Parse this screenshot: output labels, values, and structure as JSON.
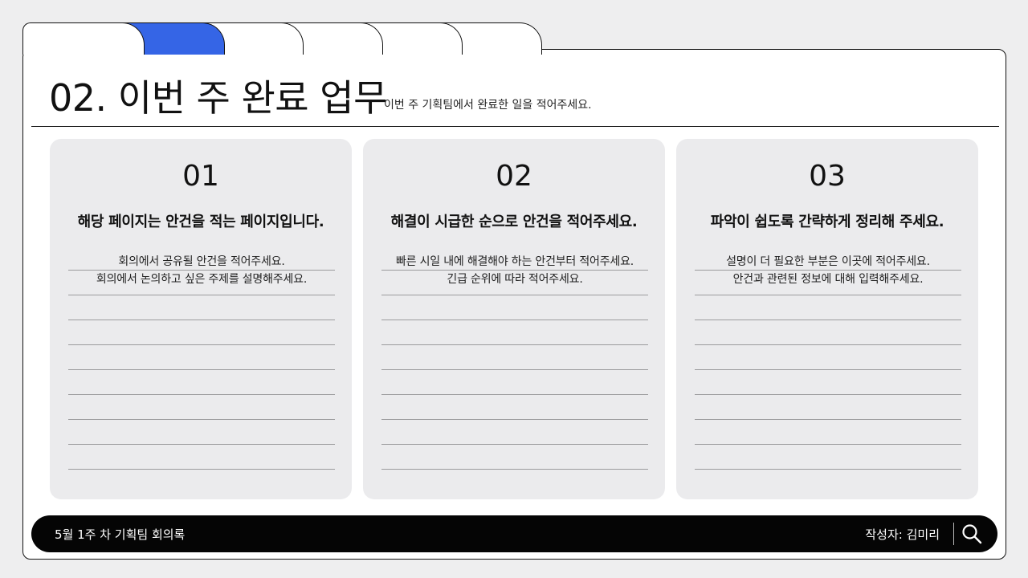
{
  "header": {
    "title": "02. 이번 주 완료 업무",
    "subtitle": "이번 주 기획팀에서 완료한 일을 적어주세요."
  },
  "tabs": [
    {
      "active": false
    },
    {
      "active": true
    },
    {
      "active": false
    },
    {
      "active": false
    },
    {
      "active": false
    },
    {
      "active": false
    }
  ],
  "panels": [
    {
      "number": "01",
      "heading": "해당 페이지는 안건을 적는 페이지입니다.",
      "lines": [
        "회의에서 공유될 안건을 적어주세요.",
        "회의에서 논의하고 싶은 주제를 설명해주세요.",
        "",
        "",
        "",
        "",
        "",
        "",
        ""
      ]
    },
    {
      "number": "02",
      "heading": "해결이 시급한 순으로 안건을 적어주세요.",
      "lines": [
        "빠른 시일 내에 해결해야 하는 안건부터 적어주세요.",
        "긴급 순위에 따라 적어주세요.",
        "",
        "",
        "",
        "",
        "",
        "",
        ""
      ]
    },
    {
      "number": "03",
      "heading": "파악이 쉽도록 간략하게 정리해 주세요.",
      "lines": [
        "설명이 더 필요한 부분은 이곳에 적어주세요.",
        "안건과 관련된 정보에 대해 입력해주세요.",
        "",
        "",
        "",
        "",
        "",
        "",
        ""
      ]
    }
  ],
  "footer": {
    "meeting": "5월 1주 차 기획팀 회의록",
    "author": "작성자: 김미리",
    "search_icon": "search-icon"
  },
  "colors": {
    "accent": "#3565e6",
    "background": "#eeeeef",
    "panel": "#ebebed",
    "bar": "#050505"
  }
}
